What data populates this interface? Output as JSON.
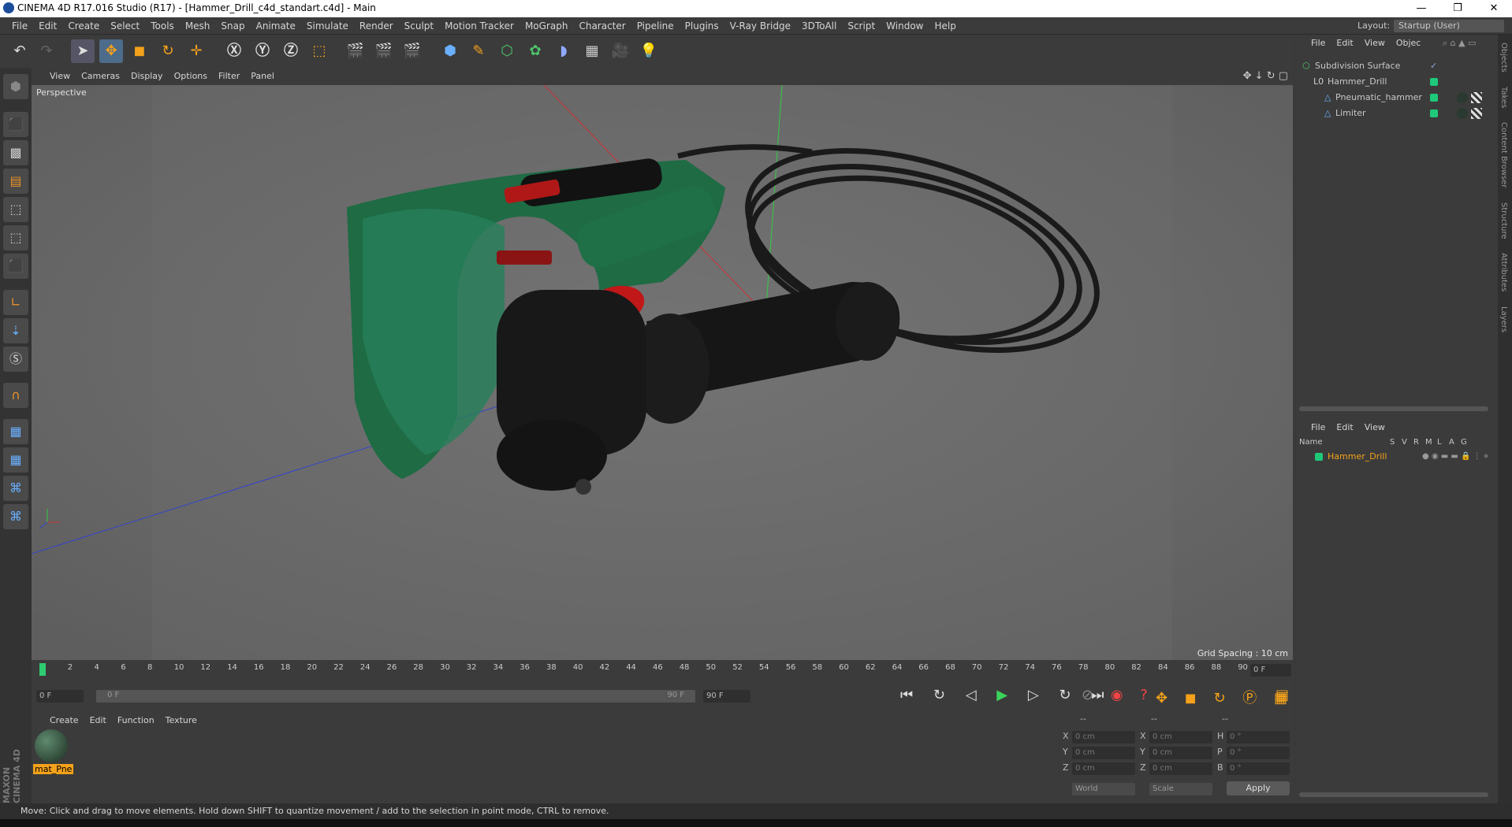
{
  "window": {
    "title": "CINEMA 4D R17.016 Studio (R17) - [Hammer_Drill_c4d_standart.c4d] - Main",
    "minimize": "—",
    "restore": "❐",
    "close": "✕"
  },
  "menu": [
    "File",
    "Edit",
    "Create",
    "Select",
    "Tools",
    "Mesh",
    "Snap",
    "Animate",
    "Simulate",
    "Render",
    "Sculpt",
    "Motion Tracker",
    "MoGraph",
    "Character",
    "Pipeline",
    "Plugins",
    "V-Ray Bridge",
    "3DToAll",
    "Script",
    "Window",
    "Help"
  ],
  "layout": {
    "label": "Layout:",
    "value": "Startup (User)"
  },
  "viewport": {
    "menu": [
      "View",
      "Cameras",
      "Display",
      "Options",
      "Filter",
      "Panel"
    ],
    "camera_label": "Perspective",
    "grid_spacing": "Grid Spacing : 10 cm"
  },
  "timeline": {
    "ticks": [
      "0",
      "2",
      "4",
      "6",
      "8",
      "10",
      "12",
      "14",
      "16",
      "18",
      "20",
      "22",
      "24",
      "26",
      "28",
      "30",
      "32",
      "34",
      "36",
      "38",
      "40",
      "42",
      "44",
      "46",
      "48",
      "50",
      "52",
      "54",
      "56",
      "58",
      "60",
      "62",
      "64",
      "66",
      "68",
      "70",
      "72",
      "74",
      "76",
      "78",
      "80",
      "82",
      "84",
      "86",
      "88",
      "90"
    ],
    "current_frame_field": "0 F",
    "start_field": "0 F",
    "slider_left": "0 F",
    "slider_right": "90 F",
    "end_field": "90 F"
  },
  "object_manager": {
    "menu": [
      "File",
      "Edit",
      "View",
      "Objec"
    ],
    "objects": [
      {
        "name": "Subdivision Surface",
        "level": 0
      },
      {
        "name": "Hammer_Drill",
        "level": 1
      },
      {
        "name": "Pneumatic_hammer",
        "level": 2
      },
      {
        "name": "Limiter",
        "level": 2
      }
    ]
  },
  "layer_manager": {
    "menu": [
      "File",
      "Edit",
      "View"
    ],
    "columns": [
      "Name",
      "S",
      "V",
      "R",
      "M",
      "L",
      "A",
      "G"
    ],
    "layers": [
      {
        "name": "Hammer_Drill",
        "color": "#1ec97a"
      }
    ]
  },
  "material_manager": {
    "menu": [
      "Create",
      "Edit",
      "Function",
      "Texture"
    ],
    "materials": [
      {
        "name": "mat_Pne"
      }
    ]
  },
  "coordinates": {
    "header": [
      "--",
      "--",
      "--"
    ],
    "rows": [
      {
        "a": "X",
        "v1": "0 cm",
        "b": "X",
        "v2": "0 cm",
        "c": "H",
        "v3": "0 °"
      },
      {
        "a": "Y",
        "v1": "0 cm",
        "b": "Y",
        "v2": "0 cm",
        "c": "P",
        "v3": "0 °"
      },
      {
        "a": "Z",
        "v1": "0 cm",
        "b": "Z",
        "v2": "0 cm",
        "c": "B",
        "v3": "0 °"
      }
    ],
    "mode1": "World",
    "mode2": "Scale",
    "apply": "Apply"
  },
  "side_tabs": [
    "Objects",
    "Takes",
    "Content Browser",
    "Structure",
    "Attributes",
    "Layers"
  ],
  "status": "Move: Click and drag to move elements. Hold down SHIFT to quantize movement / add to the selection in point mode, CTRL to remove.",
  "brand": {
    "top": "MAXON",
    "bottom": "CINEMA 4D"
  }
}
